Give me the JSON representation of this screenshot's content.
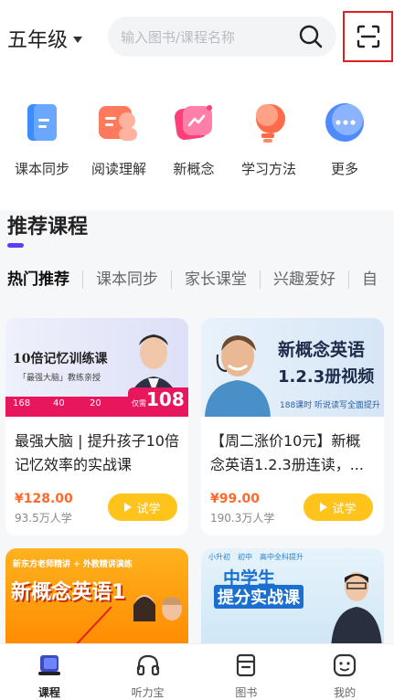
{
  "header": {
    "grade": "五年级",
    "search_placeholder": "输入图书/课程名称"
  },
  "categories": [
    {
      "label": "课本同步",
      "icon": "textbook-icon"
    },
    {
      "label": "阅读理解",
      "icon": "reading-icon"
    },
    {
      "label": "新概念",
      "icon": "new-concept-icon"
    },
    {
      "label": "学习方法",
      "icon": "study-method-icon"
    },
    {
      "label": "更多",
      "icon": "more-icon"
    }
  ],
  "recommend": {
    "title": "推荐课程",
    "tabs": [
      "热门推荐",
      "课本同步",
      "家长课堂",
      "兴趣爱好",
      "自"
    ]
  },
  "courses": [
    {
      "cover_title": "10倍记忆训练课",
      "cover_subtitle": "「最强大脑」教练亲授",
      "cover_stats": [
        "168",
        "40",
        "20"
      ],
      "cover_price": "108",
      "cover_price_label": "仅需",
      "title": "最强大脑 | 提升孩子10倍记忆效率的实战课",
      "price": "¥128.00",
      "learners": "93.5万人学",
      "button": "试学"
    },
    {
      "cover_title": "新概念英语",
      "cover_subtitle": "1.2.3册视频",
      "cover_tagline": "188课时 听说读写全面提升",
      "title": "【周二涨价10元】新概念英语1.2.3册连读，...",
      "price": "¥99.00",
      "learners": "190.3万人学",
      "button": "试学"
    }
  ],
  "courses_row2": [
    {
      "cover_title": "新概念英语1",
      "cover_top": "新东方老师精讲 + 外教精讲演练"
    },
    {
      "cover_title": "中学生",
      "cover_subtitle": "提分实战课",
      "cover_tags": [
        "小升初",
        "初中",
        "高中全科提升"
      ]
    }
  ],
  "nav": [
    {
      "label": "课程",
      "icon": "course-icon",
      "active": true
    },
    {
      "label": "听力宝",
      "icon": "headphones-icon",
      "active": false
    },
    {
      "label": "图书",
      "icon": "book-icon",
      "active": false
    },
    {
      "label": "我的",
      "icon": "profile-icon",
      "active": false
    }
  ],
  "colors": {
    "accent": "#5a3df5",
    "button": "#ffc41c",
    "price": "#ff6a2a",
    "highlight_box": "#e02020"
  }
}
